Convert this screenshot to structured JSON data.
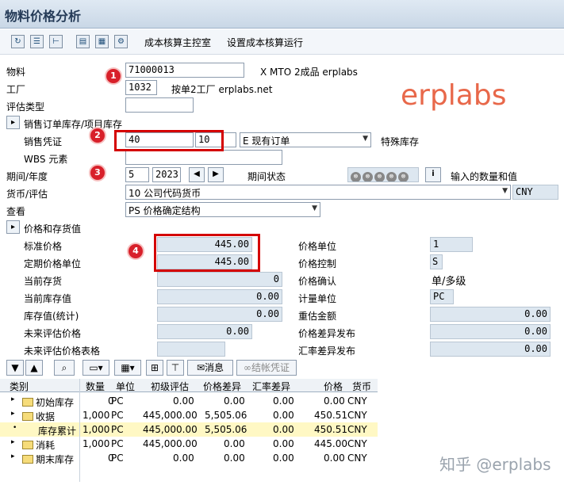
{
  "window_title": "物料价格分析",
  "toolbar": {
    "btn_main": "成本核算主控室",
    "btn_run": "设置成本核算运行"
  },
  "watermark": "erplabs",
  "footer_watermark": "知乎 @erplabs",
  "header": {
    "material_label": "物料",
    "material_value": "71000013",
    "material_desc": "X MTO 2成品 erplabs",
    "plant_label": "工厂",
    "plant_value": "1032",
    "plant_desc": "按单2工厂 erplabs.net",
    "valtype_label": "评估类型",
    "valtype_value": "",
    "so_section": "销售订单库存/项目库存",
    "so_label": "销售凭证",
    "so_value": "40",
    "so_item": "10",
    "special_stock_value": "E 现有订单",
    "special_stock_label": "特殊库存",
    "wbs_label": "WBS 元素",
    "wbs_value": "",
    "period_label": "期间/年度",
    "period_value": "5",
    "year_value": "2023",
    "period_status_label": "期间状态",
    "period_status_icons": [
      "⊗",
      "⊗",
      "⊗",
      "⊗",
      "⊗"
    ],
    "input_qty_label": "输入的数量和值",
    "currency_label": "货币/评估",
    "currency_value": "10 公司代码货币",
    "currency_unit": "CNY",
    "view_label": "查看",
    "view_value": "PS 价格确定结构"
  },
  "price_section": {
    "title": "价格和存货值",
    "std_price_label": "标准价格",
    "std_price_value": "445.00",
    "periodic_price_label": "定期价格单位",
    "periodic_price_value": "445.00",
    "cur_stock_label": "当前存货",
    "cur_stock_value": "0",
    "cur_stock_val_label": "当前库存值",
    "cur_stock_val_value": "0.00",
    "stock_stat_label": "库存值(统计)",
    "stock_stat_value": "0.00",
    "future_price_label": "未来评估价格",
    "future_price_value": "0.00",
    "future_price_table_label": "未来评估价格表格",
    "future_price_table_value": "",
    "price_unit_label": "价格单位",
    "price_unit_value": "1",
    "price_control_label": "价格控制",
    "price_control_value": "S",
    "price_determination_label": "价格确认",
    "price_determination_value": "单/多级",
    "uom_label": "计量单位",
    "uom_value": "PC",
    "reval_label": "重估金额",
    "reval_value": "0.00",
    "price_diff_post_label": "价格差异发布",
    "price_diff_post_value": "0.00",
    "exch_diff_post_label": "汇率差异发布",
    "exch_diff_post_value": "0.00"
  },
  "grid_toolbar": {
    "msg_btn": "消息",
    "close_btn": "结帐凭证"
  },
  "grid": {
    "columns": [
      "类别",
      "数量",
      "单位",
      "初级评估",
      "价格差异",
      "汇率差异",
      "价格",
      "货币"
    ],
    "rows": [
      {
        "category": "初始库存",
        "qty": "0",
        "unit": "PC",
        "primary": "0.00",
        "price_diff": "0.00",
        "exch_diff": "0.00",
        "price": "0.00",
        "currency": "CNY"
      },
      {
        "category": "收据",
        "qty": "1,000",
        "unit": "PC",
        "primary": "445,000.00",
        "price_diff": "5,505.06",
        "exch_diff": "0.00",
        "price": "450.51",
        "currency": "CNY"
      },
      {
        "category": "库存累计",
        "qty": "1,000",
        "unit": "PC",
        "primary": "445,000.00",
        "price_diff": "5,505.06",
        "exch_diff": "0.00",
        "price": "450.51",
        "currency": "CNY"
      },
      {
        "category": "消耗",
        "qty": "1,000",
        "unit": "PC",
        "primary": "445,000.00",
        "price_diff": "0.00",
        "exch_diff": "0.00",
        "price": "445.00",
        "currency": "CNY"
      },
      {
        "category": "期末库存",
        "qty": "0",
        "unit": "PC",
        "primary": "0.00",
        "price_diff": "0.00",
        "exch_diff": "0.00",
        "price": "0.00",
        "currency": "CNY"
      }
    ]
  },
  "badges": [
    "1",
    "2",
    "3",
    "4"
  ],
  "colors": {
    "accent_red": "#d40000",
    "watermark": "#e8684a",
    "title_bg": "#c9d7e6"
  }
}
